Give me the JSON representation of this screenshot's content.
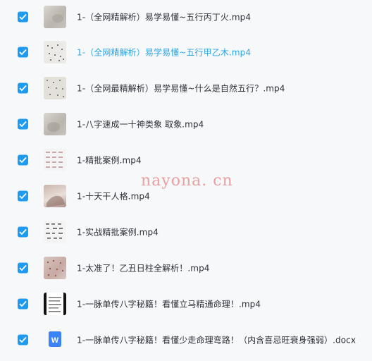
{
  "files": [
    {
      "name": "1-（全网精解析）易学易懂~五行丙丁火.mp4",
      "active": false,
      "thumb": "photo"
    },
    {
      "name": "1-（全网精解析）易学易懂~五行甲乙木.mp4",
      "active": true,
      "thumb": "paper-dots"
    },
    {
      "name": "1-（全网最精解析）易学易懂~什么是自然五行？.mp4",
      "active": false,
      "thumb": "paper-dots"
    },
    {
      "name": "1-八字速成一十神类象 取象.mp4",
      "active": false,
      "thumb": "photo"
    },
    {
      "name": "1-精批案例.mp4",
      "active": false,
      "thumb": "table-sheet"
    },
    {
      "name": "1-十天干人格.mp4",
      "active": false,
      "thumb": "hand-photo"
    },
    {
      "name": "1-实战精批案例.mp4",
      "active": false,
      "thumb": "table-sheet"
    },
    {
      "name": "1-太准了！乙丑日柱全解析！.mp4",
      "active": false,
      "thumb": "red-paper"
    },
    {
      "name": "1-一脉单传八字秘籍！看懂立马精通命理！.mp4",
      "active": false,
      "thumb": "black-frame"
    },
    {
      "name": "1-一脉单传八字秘籍！看懂少走命理弯路！（内含喜忌旺衰身强弱）.docx",
      "active": false,
      "thumb": "word-icon"
    }
  ],
  "watermark": "nayona. cn",
  "colors": {
    "checkbox": "#1d9bf0",
    "active_text": "#2aa5e4",
    "text": "#2b2f36",
    "word_icon": "#3b82f6"
  }
}
